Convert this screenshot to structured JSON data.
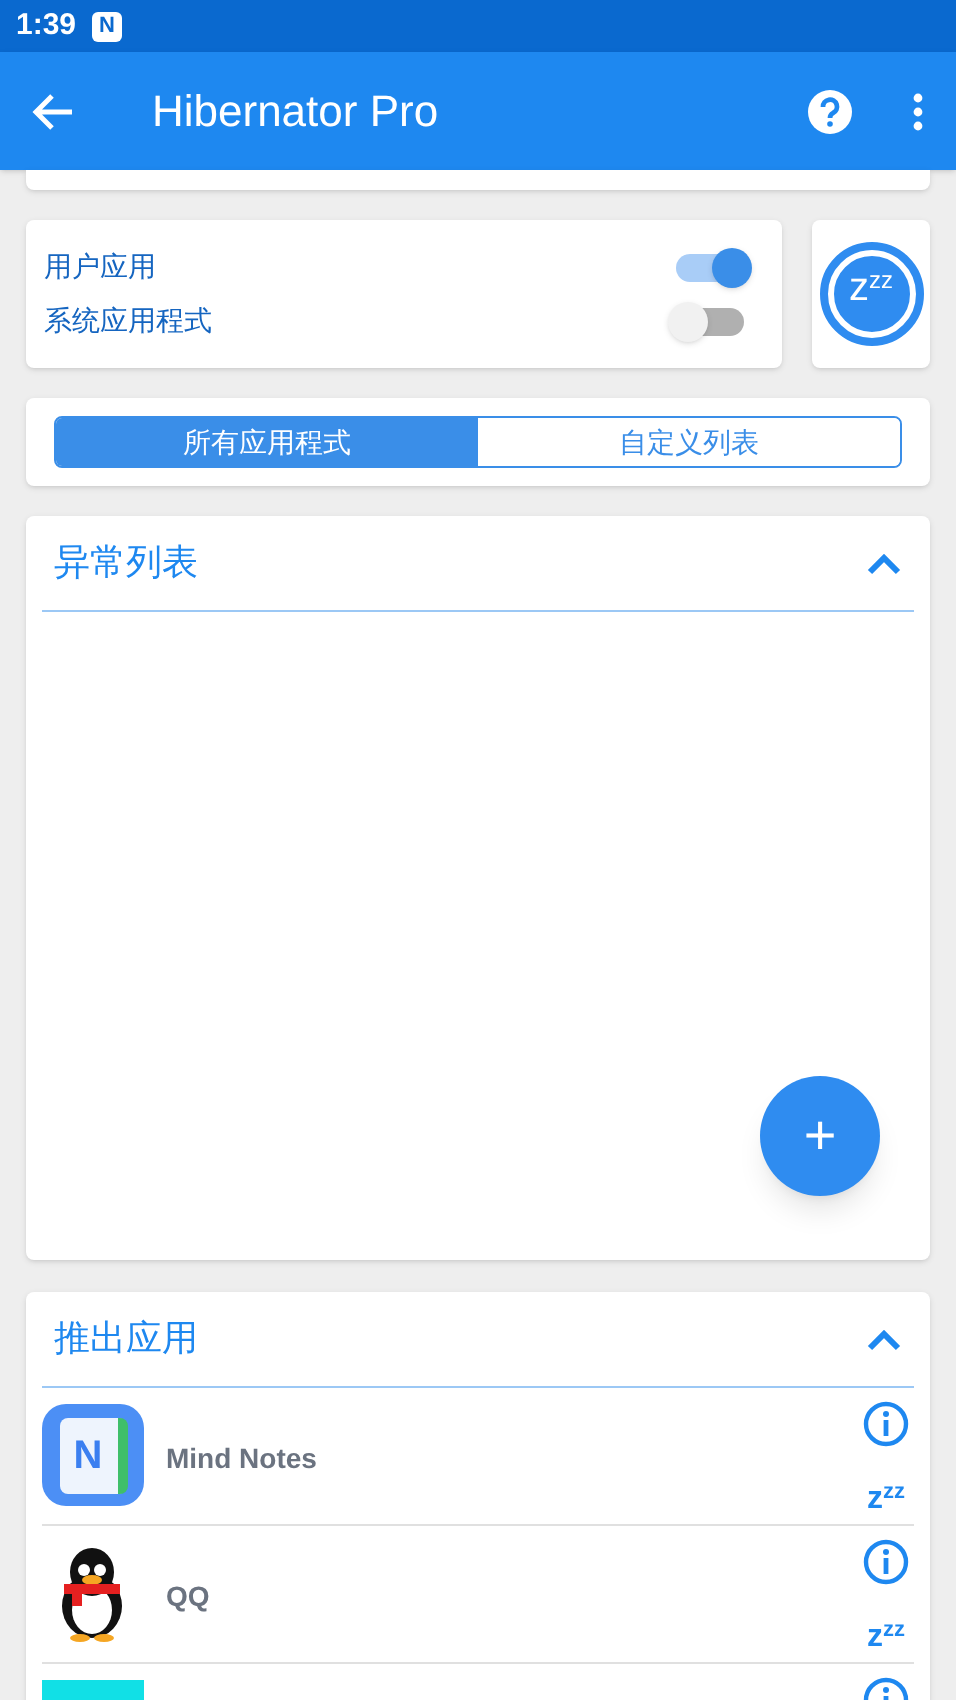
{
  "status_bar": {
    "time": "1:39",
    "notification_letter": "N"
  },
  "app_bar": {
    "title": "Hibernator Pro"
  },
  "filters": [
    {
      "label": "用户应用",
      "on": true
    },
    {
      "label": "系统应用程式",
      "on": false
    }
  ],
  "hibernate_all": {
    "label": "z$^{z}$$^{z}$"
  },
  "segments": [
    {
      "label": "所有应用程式",
      "selected": true
    },
    {
      "label": "自定义列表",
      "selected": false
    }
  ],
  "abnormal_list": {
    "title": "异常列表",
    "expanded": true
  },
  "fab": {
    "label": "+"
  },
  "exit_apps": {
    "title": "推出应用",
    "expanded": true,
    "apps": [
      {
        "kind": "notes",
        "icon_letter": "N",
        "name": "Mind Notes",
        "hibernate_label": "z$^{z}$$^{z}$"
      },
      {
        "kind": "penguin",
        "name": "QQ",
        "hibernate_label": "z$^{z}$$^{z}$"
      },
      {
        "kind": "tile"
      }
    ]
  }
}
